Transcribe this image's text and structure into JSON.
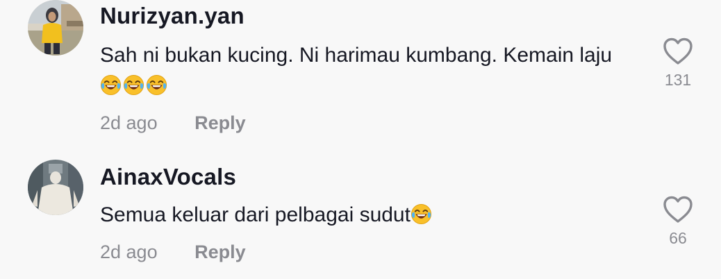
{
  "comments": [
    {
      "username": "Nurizyan.yan",
      "text": "Sah ni bukan kucing. Ni harimau kumbang. Kemain laju",
      "emoji": "face-with-tears-of-joy",
      "emoji_count": 3,
      "time": "2d ago",
      "reply_label": "Reply",
      "likes": "131"
    },
    {
      "username": "AinaxVocals",
      "text": "Semua keluar dari pelbagai sudut",
      "emoji": "face-with-tears-of-joy",
      "emoji_count": 1,
      "time": "2d ago",
      "reply_label": "Reply",
      "likes": "66"
    }
  ],
  "colors": {
    "background": "#f8f8f8",
    "text_primary": "#161823",
    "text_secondary": "#8a8b91"
  }
}
